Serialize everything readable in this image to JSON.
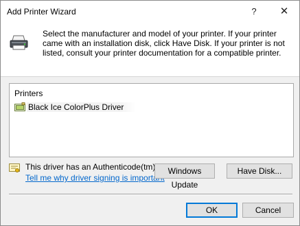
{
  "window": {
    "title": "Add Printer Wizard",
    "help_glyph": "?",
    "close_glyph": "✕"
  },
  "header": {
    "icon": "printer-icon",
    "description": "Select the manufacturer and model of your printer. If your printer came with an installation disk, click Have Disk. If your printer is not listed, consult your printer documentation for a compatible printer."
  },
  "printers": {
    "header": "Printers",
    "items": [
      {
        "label": "Black Ice ColorPlus Driver",
        "icon": "printer-driver-icon",
        "selected": true
      }
    ]
  },
  "signature": {
    "icon": "certificate-icon",
    "text": "This driver has an Authenticode(tm) signature.",
    "link": "Tell me why driver signing is important"
  },
  "buttons": {
    "windows_update": "Windows Update",
    "have_disk": "Have Disk...",
    "ok": "OK",
    "cancel": "Cancel"
  },
  "colors": {
    "link": "#0066cc",
    "default_button_border": "#0078d7",
    "dialog_bg": "#f0f0f0"
  }
}
